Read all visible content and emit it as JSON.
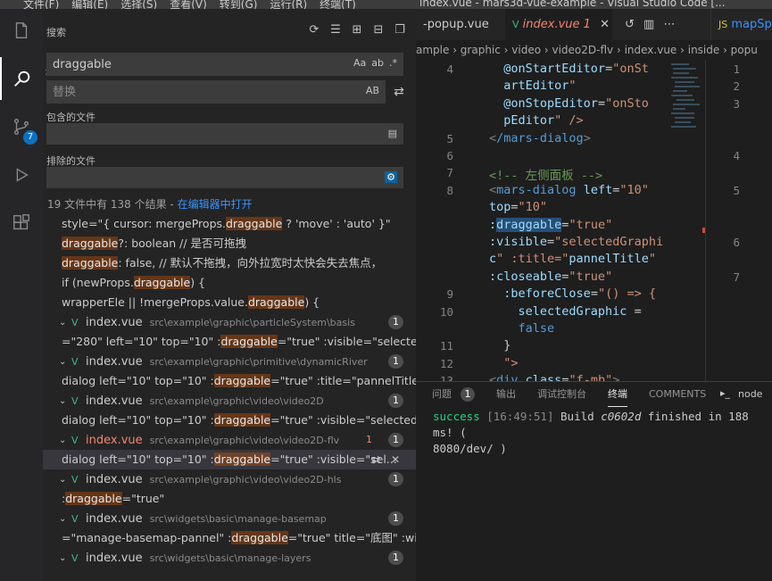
{
  "window": {
    "menu": [
      "文件(F)",
      "编辑(E)",
      "选择(S)",
      "查看(V)",
      "转到(G)",
      "运行(R)",
      "终端(T)"
    ],
    "title": "index.vue - mars3d-vue-example - Visual Studio Code [..."
  },
  "activity": {
    "scm_badge": "7"
  },
  "search": {
    "header": "搜索",
    "query": "draggable",
    "replace_placeholder": "替换",
    "replace_opt": "AB",
    "find_opts": [
      "Aa",
      "ab",
      ".*"
    ],
    "include_label": "包含的文件",
    "exclude_label": "排除的文件",
    "summary": "19 文件中有 138 个结果 - ",
    "open_in_editor": "在编辑器中打开"
  },
  "results": [
    {
      "kind": "line",
      "pre": "style=\"{ cursor: mergeProps.",
      "match": "draggable",
      "post": " ? 'move' : 'auto' }\""
    },
    {
      "kind": "line",
      "pre": "",
      "match": "draggable",
      "post": "?: boolean // 是否可拖拽"
    },
    {
      "kind": "line",
      "pre": "",
      "match": "draggable",
      "post": ": false, // 默认不拖拽，向外拉宽时太快会失去焦点，"
    },
    {
      "kind": "line",
      "pre": "if (newProps.",
      "match": "draggable",
      "post": ") {"
    },
    {
      "kind": "line",
      "pre": "wrapperEle || !mergeProps.value.",
      "match": "draggable",
      "post": ") {"
    },
    {
      "kind": "file",
      "name": "index.vue",
      "path": "src\\example\\graphic\\particleSystem\\basis",
      "count": "1"
    },
    {
      "kind": "line",
      "pre": "=\"280\" left=\"10\" top=\"10\" :",
      "match": "draggable",
      "post": "=\"true\" :visible=\"selectedGra..."
    },
    {
      "kind": "file",
      "name": "index.vue",
      "path": "src\\example\\graphic\\primitive\\dynamicRiver",
      "count": "1"
    },
    {
      "kind": "line",
      "pre": "dialog left=\"10\" top=\"10\" :",
      "match": "draggable",
      "post": "=\"true\" :title=\"pannelTitle\" :vis..."
    },
    {
      "kind": "file",
      "name": "index.vue",
      "path": "src\\example\\graphic\\video\\video2D",
      "count": "1"
    },
    {
      "kind": "line",
      "pre": "dialog left=\"10\" top=\"10\" :",
      "match": "draggable",
      "post": "=\"true\" :visible=\"selectedGrap..."
    },
    {
      "kind": "file",
      "name": "index.vue",
      "path": "src\\example\\graphic\\video\\video2D-flv",
      "count": "1",
      "modified": "1"
    },
    {
      "kind": "line",
      "pre": "dialog left=\"10\" top=\"10\" :",
      "match": "draggable",
      "post": "=\"true\" :visible=\"sel...",
      "selected": true
    },
    {
      "kind": "file",
      "name": "index.vue",
      "path": "src\\example\\graphic\\video\\video2D-hls",
      "count": "1"
    },
    {
      "kind": "line",
      "pre": ":",
      "match": "draggable",
      "post": "=\"true\""
    },
    {
      "kind": "file",
      "name": "index.vue",
      "path": "src\\widgets\\basic\\manage-basemap",
      "count": "1"
    },
    {
      "kind": "line",
      "pre": "=\"manage-basemap-pannel\" :",
      "match": "draggable",
      "post": "=\"true\" title=\"底图\" :width..."
    },
    {
      "kind": "file",
      "name": "index.vue",
      "path": "src\\widgets\\basic\\manage-layers",
      "count": "1"
    }
  ],
  "editor": {
    "tabs": [
      "-popup.vue",
      "index.vue 1",
      "mapSplit"
    ],
    "breadcrumb": "ample › graphic › video › video2D-flv › index.vue › inside › popu",
    "line_numbers": [
      "4",
      "",
      "",
      "",
      "5",
      "6",
      "7",
      "8",
      "",
      "",
      "",
      "",
      "",
      "9",
      "10",
      "",
      "11",
      "12",
      "13"
    ],
    "code": [
      "  @onStartEditor=\"onSt",
      "  artEditor\"",
      "  @onStopEditor=\"onSto",
      "  pEditor\" />",
      "</mars-dialog>",
      "",
      "<!-- 左侧面板 -->",
      "<mars-dialog left=\"10\"",
      "top=\"10\"",
      ":draggable=\"true\"",
      ":visible=\"selectedGraphi",
      "c\" :title=\"pannelTitle\"",
      ":closeable=\"true\"",
      "  :beforeClose=\"() => {",
      "    selectedGraphic =",
      "    false",
      "  }",
      "  \">",
      "<div class=\"f-mb\">"
    ],
    "split_lines": [
      "1",
      "2",
      "3",
      "",
      "",
      "4",
      "",
      "5",
      "",
      "",
      "6",
      "",
      "7"
    ]
  },
  "panel": {
    "tabs": [
      "问题",
      "输出",
      "调试控制台",
      "终端",
      "COMMENTS",
      "node"
    ],
    "problems_badge": "1",
    "terminal": {
      "status": "success",
      "time": "[16:49:51]",
      "msg": "Build",
      "hash": "c0602d",
      "rest": "finished in 188 ms! (",
      "line2": "8080/dev/ )"
    }
  }
}
